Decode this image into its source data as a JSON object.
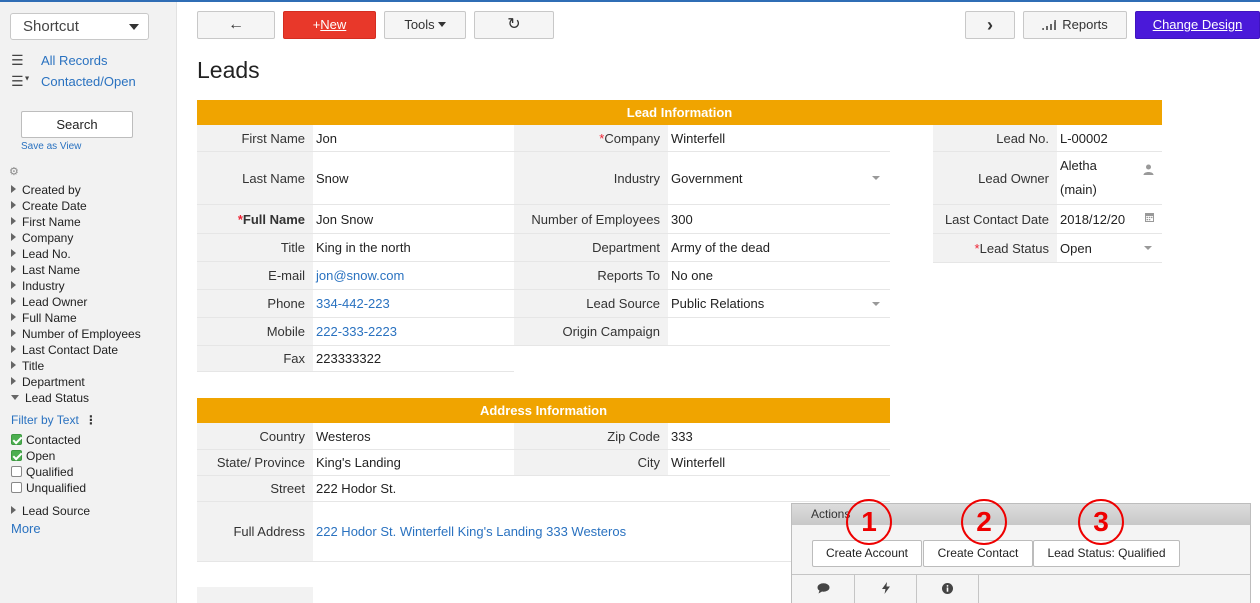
{
  "sidebar": {
    "shortcut": "Shortcut",
    "views": [
      {
        "icon": "☰",
        "label": "All Records"
      },
      {
        "icon": "☰",
        "label": "Contacted/Open"
      }
    ],
    "search_label": "Search",
    "save_as_view": "Save as View",
    "filters": [
      "Created by",
      "Create Date",
      "First Name",
      "Company",
      "Lead No.",
      "Last Name",
      "Industry",
      "Lead Owner",
      "Full Name",
      "Number of Employees",
      "Last Contact Date",
      "Title",
      "Department",
      "Lead Status"
    ],
    "filter_by_text": "Filter by Text",
    "status_options": [
      {
        "label": "Contacted",
        "checked": true
      },
      {
        "label": "Open",
        "checked": true
      },
      {
        "label": "Qualified",
        "checked": false
      },
      {
        "label": "Unqualified",
        "checked": false
      }
    ],
    "lead_source": "Lead Source",
    "more": "More"
  },
  "toolbar": {
    "back_icon": "←",
    "new_prefix": "+",
    "new_label": "New",
    "tools_label": "Tools",
    "refresh_icon": "↻",
    "next_icon": "›",
    "reports_label": "Reports",
    "change_design_label": "Change Design"
  },
  "page_title": "Leads",
  "lead_info": {
    "header": "Lead Information",
    "first_name_label": "First Name",
    "first_name": "Jon",
    "last_name_label": "Last Name",
    "last_name": "Snow",
    "full_name_label": "Full Name",
    "full_name": "Jon Snow",
    "title_label": "Title",
    "title": "King in the north",
    "email_label": "E-mail",
    "email": "jon@snow.com",
    "phone_label": "Phone",
    "phone": "334-442-223",
    "mobile_label": "Mobile",
    "mobile": "222-333-2223",
    "fax_label": "Fax",
    "fax": "223333322",
    "company_label": "Company",
    "company": "Winterfell",
    "industry_label": "Industry",
    "industry": "Government",
    "employees_label": "Number of Employees",
    "employees": "300",
    "department_label": "Department",
    "department": "Army of the dead",
    "reports_to_label": "Reports To",
    "reports_to": "No one",
    "lead_source_label": "Lead Source",
    "lead_source": "Public Relations",
    "origin_campaign_label": "Origin Campaign",
    "origin_campaign": "",
    "lead_no_label": "Lead No.",
    "lead_no": "L-00002",
    "lead_owner_label": "Lead Owner",
    "lead_owner_1": "Aletha",
    "lead_owner_2": "(main)",
    "last_contact_label": "Last Contact Date",
    "last_contact": "2018/12/20",
    "lead_status_label": "Lead Status",
    "lead_status": "Open"
  },
  "address_info": {
    "header": "Address Information",
    "country_label": "Country",
    "country": "Westeros",
    "state_label": "State/ Province",
    "state": "King's Landing",
    "street_label": "Street",
    "street": "222 Hodor St.",
    "full_address_label": "Full Address",
    "full_address": "222 Hodor St. Winterfell King's Landing 333 Westeros",
    "zip_label": "Zip Code",
    "zip": "333",
    "city_label": "City",
    "city": "Winterfell"
  },
  "actions": {
    "title": "Actions",
    "create_account": "Create Account",
    "create_contact": "Create Contact",
    "lead_status_qualified": "Lead Status: Qualified",
    "markers": [
      "1",
      "2",
      "3"
    ],
    "bar_icons": [
      "comment-icon",
      "lightning-icon",
      "info-icon"
    ]
  },
  "colors": {
    "section_header": "#f0a400",
    "new_button": "#e8382a",
    "change_design_button": "#4a19d9",
    "link": "#2a72c0",
    "annotation": "#ee0000"
  }
}
